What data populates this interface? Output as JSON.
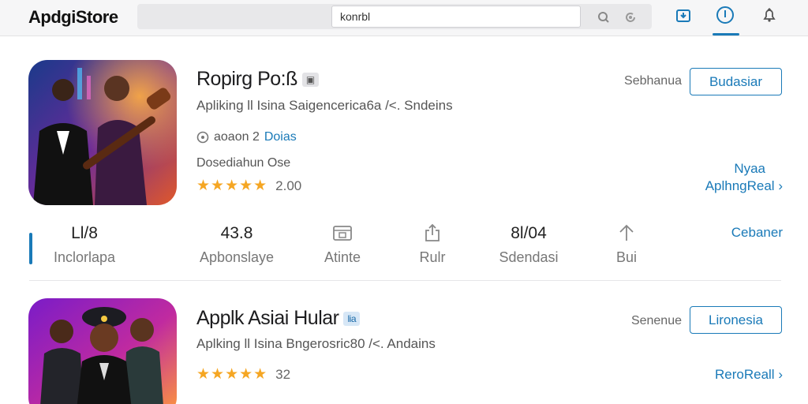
{
  "header": {
    "brand": "ApdgiStore",
    "search_value": "konrbl"
  },
  "apps": [
    {
      "title": "Ropirg Po:ß",
      "subtitle": "Apliking ll  Isina Saigencerica6a /<. Sndeins",
      "meta_text": "aoaon 2",
      "meta_link": "Doias",
      "description": "Dosediahun Ose",
      "stars": "★★★★★",
      "rating": "2.00",
      "side_label": "Sebhanua",
      "action_button": "Budasiar",
      "link_top": "Nyaa",
      "link_main": "AplhngReal"
    },
    {
      "title": "Applk Asiai Hular",
      "subtitle": "Aplking ll  Isina Bngerosric80 /<. Andains",
      "stars": "★★★★★",
      "rating": "32",
      "side_label": "Senenue",
      "action_button": "Lironesia",
      "link_main": "ReroReall"
    }
  ],
  "stats": [
    {
      "value": "Ll/8",
      "label": "Inclorlapa"
    },
    {
      "value": "43.8",
      "label": "Apbonslaye"
    },
    {
      "icon": "calendar-icon",
      "label": "Atinte"
    },
    {
      "icon": "share-icon",
      "label": "Rulr"
    },
    {
      "value": "8l/04",
      "label": "Sdendasi"
    },
    {
      "icon": "arrow-up-icon",
      "label": "Bui"
    }
  ],
  "stats_link": "Cebaner",
  "colors": {
    "accent": "#1a7ab8",
    "star": "#f5a623"
  }
}
